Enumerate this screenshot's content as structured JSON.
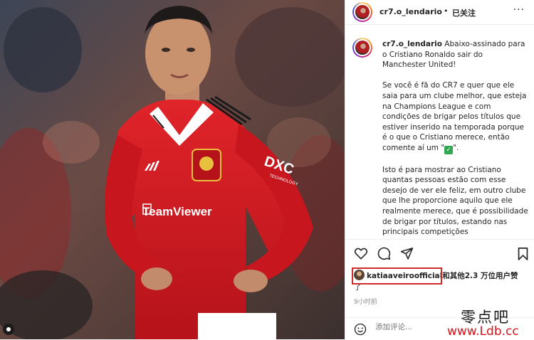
{
  "post": {
    "image": {
      "shirt_sponsor": "TeamViewer",
      "sleeve_sponsor": "DXC",
      "sleeve_sponsor_sub": "TECHNOLOGY"
    }
  },
  "header": {
    "username": "cr7.o_lendario",
    "separator": "•",
    "follow_status": "已关注",
    "more": "···"
  },
  "caption": {
    "username": "cr7.o_lendario",
    "paragraph1": "Abaixo-assinado para o Cristiano Ronaldo sair do Manchester United!",
    "paragraph2": "Se você é fã do CR7 e quer que ele saia para um clube melhor, que esteja na Champions League e com condições de brigar pelos títulos que estiver inserido na temporada porque é o que o Cristiano merece, então comente aí um \"",
    "check_glyph": "✓",
    "paragraph2_end": "\".",
    "paragraph3": "Isto é para mostrar ao Cristiano quantas pessoas estão com esse desejo de ver ele feliz, em outro clube que lhe proporcione aquilo que ele realmente merece, que é possibilidade de brigar por títulos, estando nas principais competições"
  },
  "actions": {
    "like": "heart-icon",
    "comment": "comment-icon",
    "share": "share-icon",
    "save": "bookmark-icon"
  },
  "likes": {
    "username": "katiaaveiroofficial",
    "rest": "和其他2.3 万位用户赞",
    "rest_line2": "了"
  },
  "timestamp": "9小时前",
  "comment": {
    "placeholder": "添加评论..."
  },
  "watermark": {
    "line1": "零点吧",
    "line2": "www.Ldb.cc"
  },
  "colors": {
    "kit_red": "#d0171d",
    "highlight": "#d22a2a",
    "watermark_red": "#d4141a"
  }
}
